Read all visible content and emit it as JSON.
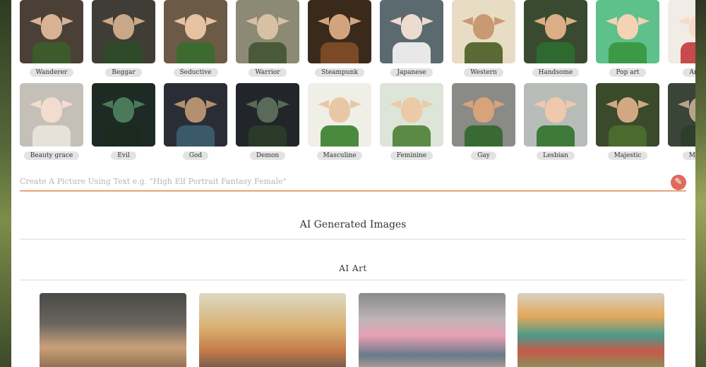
{
  "styles_row_1": [
    {
      "label": "Wanderer",
      "bg": "#4a4036",
      "face": "#d9b294",
      "body": "#3d5a2c",
      "ear": "#d9b294"
    },
    {
      "label": "Beggar",
      "bg": "#3f3d36",
      "face": "#c9a888",
      "body": "#2e4a28",
      "ear": "#c9a888"
    },
    {
      "label": "Seductive",
      "bg": "#6b5a45",
      "face": "#e6c2a2",
      "body": "#3d6a2e",
      "ear": "#e6c2a2"
    },
    {
      "label": "Warrior",
      "bg": "#8c8a74",
      "face": "#d8c0a4",
      "body": "#4a5a38",
      "ear": "#d8c0a4"
    },
    {
      "label": "Steampunk",
      "bg": "#3a2a1c",
      "face": "#d2a47e",
      "body": "#7a4a26",
      "ear": "#d2a47e"
    },
    {
      "label": "Japanese",
      "bg": "#5b6a6e",
      "face": "#ecdcd0",
      "body": "#e8e8e8",
      "ear": "#ecdcd0"
    },
    {
      "label": "Western",
      "bg": "#e8dcc4",
      "face": "#c89a72",
      "body": "#5a6a34",
      "ear": "#c89a72"
    },
    {
      "label": "Handsome",
      "bg": "#3a4a30",
      "face": "#dcae86",
      "body": "#2e6a30",
      "ear": "#dcae86"
    },
    {
      "label": "Pop art",
      "bg": "#5ec08a",
      "face": "#f4d2b4",
      "body": "#3a9a46",
      "ear": "#f4d2b4"
    },
    {
      "label": "Anime",
      "bg": "#f2ece6",
      "face": "#f4dcc8",
      "body": "#c84a4a",
      "ear": "#f4dcc8"
    }
  ],
  "styles_row_2": [
    {
      "label": "Beauty grace",
      "bg": "#c4c0b8",
      "face": "#f2dcd0",
      "body": "#e6e2da",
      "ear": "#f2dcd0"
    },
    {
      "label": "Evil",
      "bg": "#1e2a24",
      "face": "#4a7a5a",
      "body": "#1a2a1e",
      "ear": "#4a7a5a"
    },
    {
      "label": "God",
      "bg": "#2a2e34",
      "face": "#b49070",
      "body": "#3a5a6a",
      "ear": "#b49070"
    },
    {
      "label": "Demon",
      "bg": "#22262a",
      "face": "#5a6a58",
      "body": "#2a3a28",
      "ear": "#5a6a58"
    },
    {
      "label": "Masculine",
      "bg": "#efefe8",
      "face": "#e8c8a4",
      "body": "#4a8a3e",
      "ear": "#e8c8a4"
    },
    {
      "label": "Feminine",
      "bg": "#dde4d8",
      "face": "#eccaa8",
      "body": "#5a8a46",
      "ear": "#eccaa8"
    },
    {
      "label": "Gay",
      "bg": "#8a8a86",
      "face": "#d8a27a",
      "body": "#3a6a34",
      "ear": "#d8a27a"
    },
    {
      "label": "Lesbian",
      "bg": "#b8bcb8",
      "face": "#f0c8ae",
      "body": "#3e7a3a",
      "ear": "#f0c8ae"
    },
    {
      "label": "Majestic",
      "bg": "#3a4a2a",
      "face": "#d2a882",
      "body": "#4a6a2e",
      "ear": "#d2a882"
    },
    {
      "label": "Mystic",
      "bg": "#3a4438",
      "face": "#b8a48a",
      "body": "#2e3e2a",
      "ear": "#b8a48a"
    }
  ],
  "prompt": {
    "placeholder": "Create A Picture Using Text e.g. \"High Elf Portrait Fantasy Female\"",
    "value": ""
  },
  "section_ai_generated": "AI Generated Images",
  "section_ai_art": "AI Art",
  "art_cards": [
    {
      "name": "elf-portrait",
      "bg": "linear-gradient(180deg,#4a4a46 0%,#6a6660 40%,#caa07a 70%,#8a6a4a 100%)"
    },
    {
      "name": "cowboy-cartoon",
      "bg": "linear-gradient(180deg,#ddd9c4 0%,#d8b070 45%,#c47a4a 75%,#6a5a4a 100%)"
    },
    {
      "name": "mountain-watercolor",
      "bg": "linear-gradient(180deg,#8a8a8a 0%,#c0b4b8 35%,#e8a0b4 55%,#6a7a8a 80%,#b4a49a 100%)"
    },
    {
      "name": "house-watercolor",
      "bg": "linear-gradient(180deg,#d8d0c4 0%,#e4a85a 30%,#4a9a8a 55%,#c85a4a 75%,#7a9a5a 100%)"
    }
  ],
  "colors": {
    "accent": "#e8a47a",
    "brush_button": "#e06a5c"
  }
}
